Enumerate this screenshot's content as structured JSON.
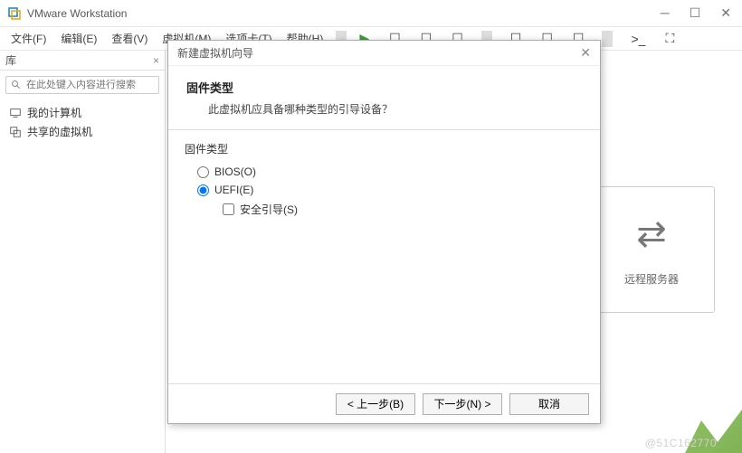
{
  "titlebar": {
    "title": "VMware Workstation"
  },
  "menu": {
    "file": "文件(F)",
    "edit": "编辑(E)",
    "view": "查看(V)",
    "vm": "虚拟机(M)",
    "tabs": "选项卡(T)",
    "help": "帮助(H)"
  },
  "sidebar": {
    "header": "库",
    "search_placeholder": "在此处键入内容进行搜索",
    "items": [
      {
        "label": "我的计算机"
      },
      {
        "label": "共享的虚拟机"
      }
    ]
  },
  "card": {
    "label": "远程服务器"
  },
  "dialog": {
    "title": "新建虚拟机向导",
    "head_title": "固件类型",
    "head_sub": "此虚拟机应具备哪种类型的引导设备？",
    "group": "固件类型",
    "radio_bios": "BIOS(O)",
    "radio_uefi": "UEFI(E)",
    "check_secure": "安全引导(S)",
    "btn_back": "< 上一步(B)",
    "btn_next": "下一步(N) >",
    "btn_cancel": "取消"
  },
  "watermark": "@51C162770"
}
